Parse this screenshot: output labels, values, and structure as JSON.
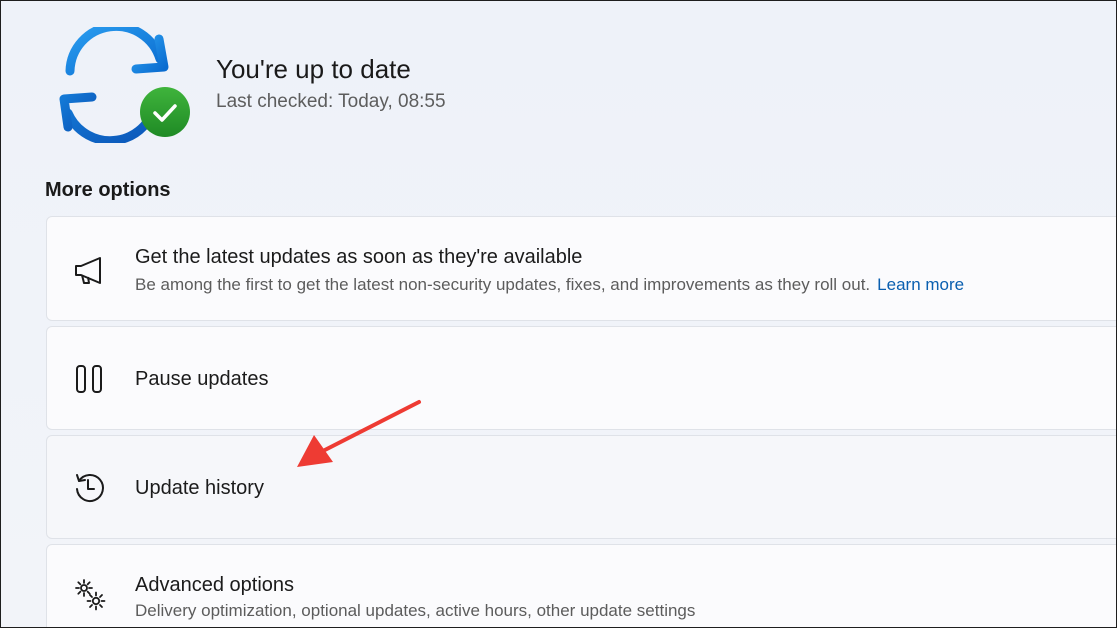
{
  "status": {
    "title": "You're up to date",
    "subtitle": "Last checked: Today, 08:55",
    "icon": "sync-check-icon"
  },
  "more_options": {
    "heading": "More options",
    "items": [
      {
        "icon": "megaphone-icon",
        "title": "Get the latest updates as soon as they're available",
        "description": "Be among the first to get the latest non-security updates, fixes, and improvements as they roll out.",
        "link": "Learn more"
      },
      {
        "icon": "pause-icon",
        "title": "Pause updates"
      },
      {
        "icon": "history-icon",
        "title": "Update history"
      },
      {
        "icon": "gears-icon",
        "title": "Advanced options",
        "description": "Delivery optimization, optional updates, active hours, other update settings"
      }
    ]
  },
  "colors": {
    "accent_blue": "#0078d4",
    "success_green": "#2e9e2e",
    "link": "#0a5fb0",
    "annotation_red": "#ee3b33"
  }
}
